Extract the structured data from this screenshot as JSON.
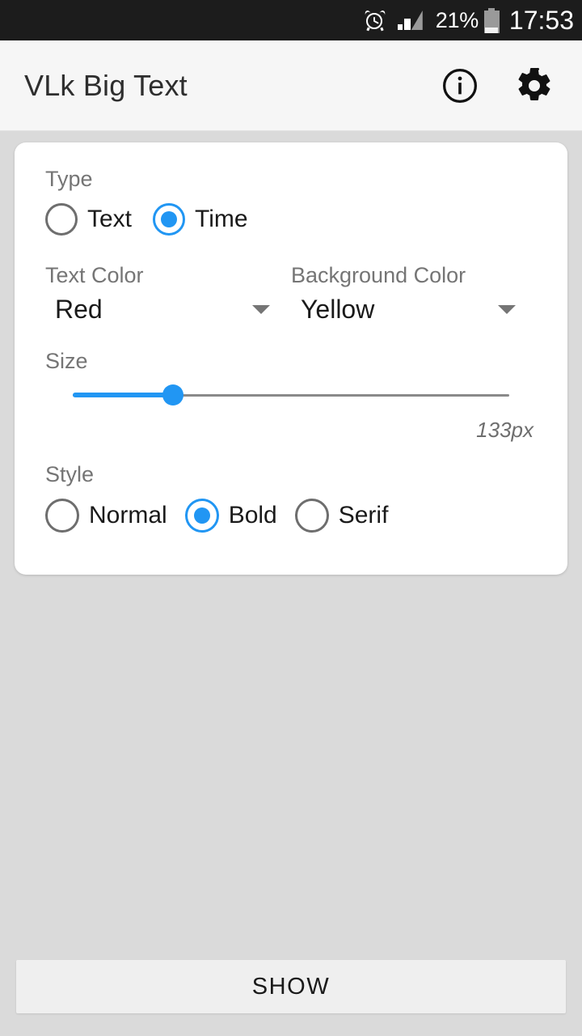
{
  "status_bar": {
    "alarm_icon": "alarm-clock-icon",
    "signal_icon": "signal-bars-icon",
    "battery_percent": "21%",
    "battery_icon": "battery-icon",
    "clock": "17:53"
  },
  "app_bar": {
    "title": "VLk Big Text",
    "info_icon": "info-icon",
    "settings_icon": "gear-icon"
  },
  "form": {
    "type": {
      "label": "Type",
      "options": [
        {
          "label": "Text",
          "selected": false
        },
        {
          "label": "Time",
          "selected": true
        }
      ]
    },
    "text_color": {
      "label": "Text Color",
      "value": "Red"
    },
    "background_color": {
      "label": "Background Color",
      "value": "Yellow"
    },
    "size": {
      "label": "Size",
      "value_text": "133px",
      "value": 133,
      "percent": 23
    },
    "style": {
      "label": "Style",
      "options": [
        {
          "label": "Normal",
          "selected": false
        },
        {
          "label": "Bold",
          "selected": true
        },
        {
          "label": "Serif",
          "selected": false
        }
      ]
    }
  },
  "actions": {
    "show_label": "SHOW"
  },
  "colors": {
    "accent": "#2196f3",
    "page_background": "#dadada",
    "card_background": "#ffffff",
    "app_bar_background": "#f6f6f6",
    "status_bar_background": "#1c1c1c",
    "label_gray": "#757575",
    "button_background": "#efefef"
  }
}
